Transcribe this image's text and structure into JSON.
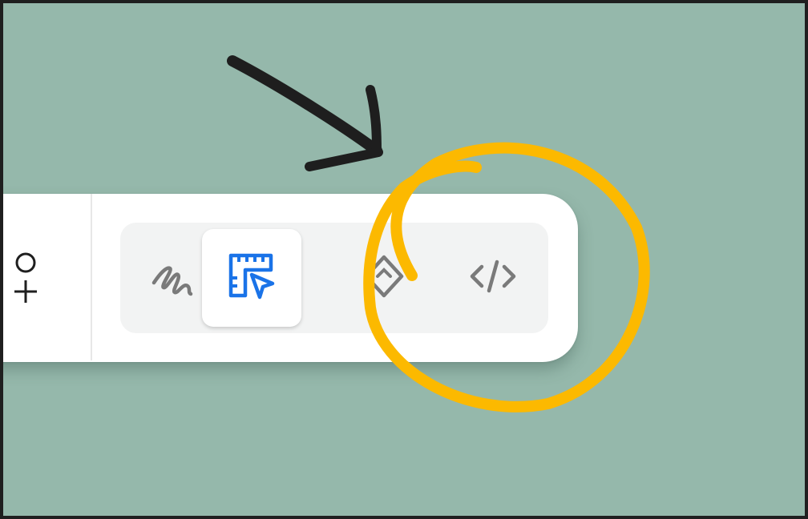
{
  "colors": {
    "background": "#95b8ab",
    "toolbar": "#ffffff",
    "mode_group": "#f2f3f3",
    "active_icon": "#1a73e8",
    "inactive_icon": "#7a7a7a",
    "highlight_circle": "#fcb900",
    "arrow": "#1e1e1e"
  },
  "toolbar": {
    "modes": [
      {
        "id": "draw",
        "icon": "scribble-icon",
        "active": false
      },
      {
        "id": "design",
        "icon": "ruler-cursor-icon",
        "active": true
      },
      {
        "id": "prototype",
        "icon": "diamond-icon",
        "active": false
      },
      {
        "id": "code",
        "icon": "code-brackets-icon",
        "active": false
      }
    ],
    "user_action_icon": "user-add-icon"
  },
  "annotations": {
    "arrow": "hand-drawn-arrow",
    "circle": "hand-drawn-circle-highlight",
    "circled_target": "code-brackets-icon"
  }
}
